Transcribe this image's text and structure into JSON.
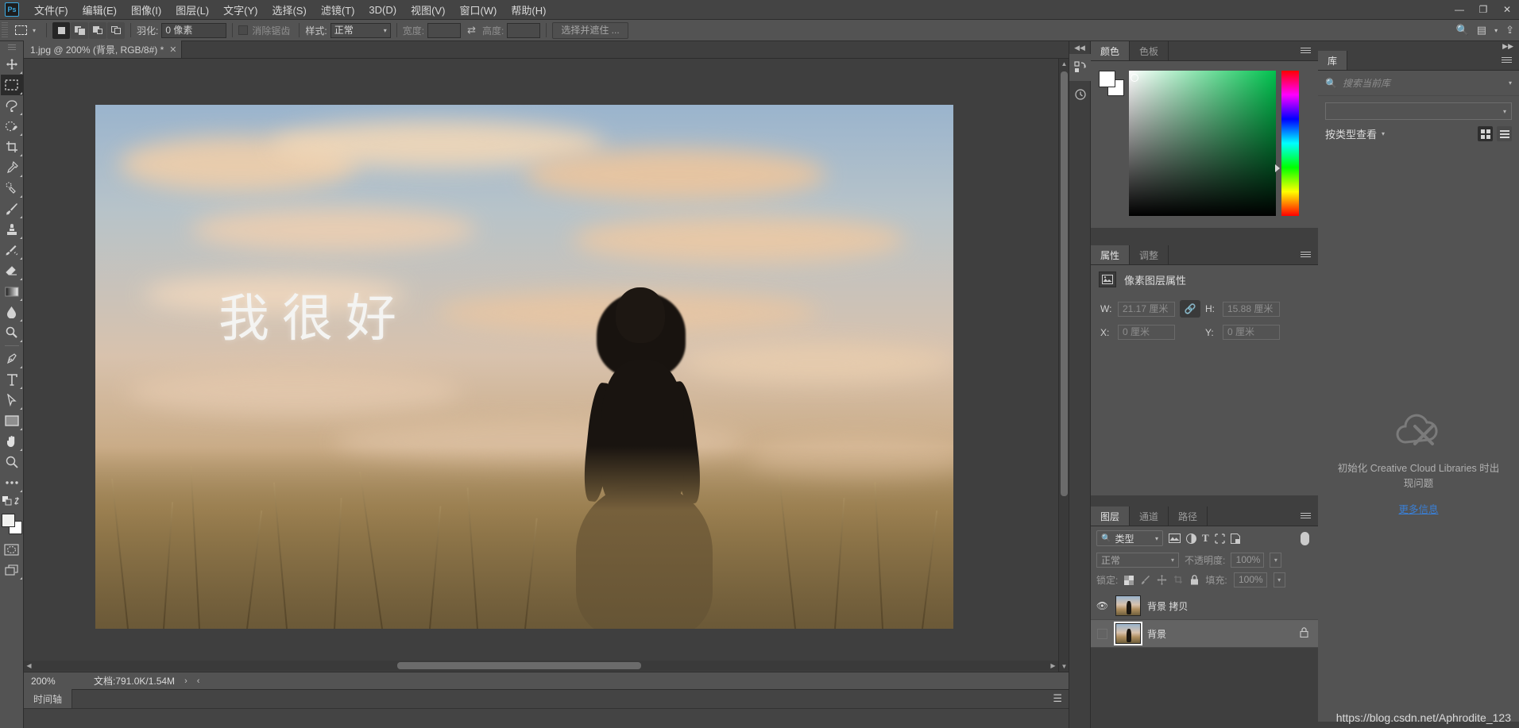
{
  "app": {
    "logo_text": "Ps"
  },
  "menubar": {
    "items": [
      {
        "label": "文件(F)"
      },
      {
        "label": "编辑(E)"
      },
      {
        "label": "图像(I)"
      },
      {
        "label": "图层(L)"
      },
      {
        "label": "文字(Y)"
      },
      {
        "label": "选择(S)"
      },
      {
        "label": "滤镜(T)"
      },
      {
        "label": "3D(D)"
      },
      {
        "label": "视图(V)"
      },
      {
        "label": "窗口(W)"
      },
      {
        "label": "帮助(H)"
      }
    ],
    "window_controls": {
      "minimize": "—",
      "maximize": "❐",
      "close": "✕"
    }
  },
  "options_bar": {
    "feather_label": "羽化:",
    "feather_value": "0 像素",
    "antialias_label": "消除锯齿",
    "style_label": "样式:",
    "style_value": "正常",
    "width_label": "宽度:",
    "width_value": "",
    "height_label": "高度:",
    "height_value": "",
    "select_mask_button": "选择并遮住 ..."
  },
  "toolbar": {
    "tools": [
      {
        "name": "move-tool",
        "selected": false
      },
      {
        "name": "rectangular-marquee-tool",
        "selected": true
      },
      {
        "name": "lasso-tool",
        "selected": false
      },
      {
        "name": "quick-selection-tool",
        "selected": false
      },
      {
        "name": "crop-tool",
        "selected": false
      },
      {
        "name": "eyedropper-tool",
        "selected": false
      },
      {
        "name": "healing-brush-tool",
        "selected": false
      },
      {
        "name": "brush-tool",
        "selected": false
      },
      {
        "name": "clone-stamp-tool",
        "selected": false
      },
      {
        "name": "history-brush-tool",
        "selected": false
      },
      {
        "name": "eraser-tool",
        "selected": false
      },
      {
        "name": "gradient-tool",
        "selected": false
      },
      {
        "name": "blur-tool",
        "selected": false
      },
      {
        "name": "dodge-tool",
        "selected": false
      },
      {
        "name": "pen-tool",
        "selected": false
      },
      {
        "name": "type-tool",
        "selected": false
      },
      {
        "name": "path-selection-tool",
        "selected": false
      },
      {
        "name": "rectangle-tool",
        "selected": false
      },
      {
        "name": "hand-tool",
        "selected": false
      },
      {
        "name": "zoom-tool",
        "selected": false
      },
      {
        "name": "edit-toolbar-tool",
        "selected": false
      }
    ],
    "foreground_color": "#f2f2f0",
    "background_color": "#ffffff"
  },
  "document": {
    "tab_title": "1.jpg @ 200% (背景, RGB/8#) *",
    "close_glyph": "✕",
    "canvas_text": "我很好"
  },
  "status_bar": {
    "zoom": "200%",
    "doc_info": "文档:791.0K/1.54M",
    "next_glyph": "›",
    "prev_glyph": "‹"
  },
  "timeline": {
    "tab_label": "时间轴"
  },
  "color_panel": {
    "tabs": [
      {
        "label": "颜色",
        "active": true
      },
      {
        "label": "色板",
        "active": false
      }
    ],
    "field_gradient_to": "#00c24e"
  },
  "properties_panel": {
    "tabs": [
      {
        "label": "属性",
        "active": true
      },
      {
        "label": "调整",
        "active": false
      }
    ],
    "title": "像素图层属性",
    "fields": [
      {
        "label": "W:",
        "value": "21.17 厘米"
      },
      {
        "label": "H:",
        "value": "15.88 厘米"
      },
      {
        "label": "X:",
        "value": "0 厘米"
      },
      {
        "label": "Y:",
        "value": "0 厘米"
      }
    ],
    "link_icon": "chain-link-icon"
  },
  "layers_panel": {
    "tabs": [
      {
        "label": "图层",
        "active": true
      },
      {
        "label": "通道",
        "active": false
      },
      {
        "label": "路径",
        "active": false
      }
    ],
    "filter_label": "类型",
    "blend_mode": "正常",
    "opacity_label": "不透明度:",
    "opacity_value": "100%",
    "lock_label": "锁定:",
    "fill_label": "填充:",
    "fill_value": "100%",
    "rows": [
      {
        "name": "背景 拷贝",
        "visible": true,
        "selected": false,
        "locked": false
      },
      {
        "name": "背景",
        "visible": false,
        "selected": true,
        "locked": true
      }
    ]
  },
  "libraries_panel": {
    "tab_label": "库",
    "search_placeholder": "搜索当前库",
    "view_label": "按类型查看",
    "error_message": "初始化 Creative Cloud Libraries 时出现问题",
    "more_info_link": "更多信息"
  },
  "watermark": {
    "text": "https://blog.csdn.net/Aphrodite_123"
  }
}
